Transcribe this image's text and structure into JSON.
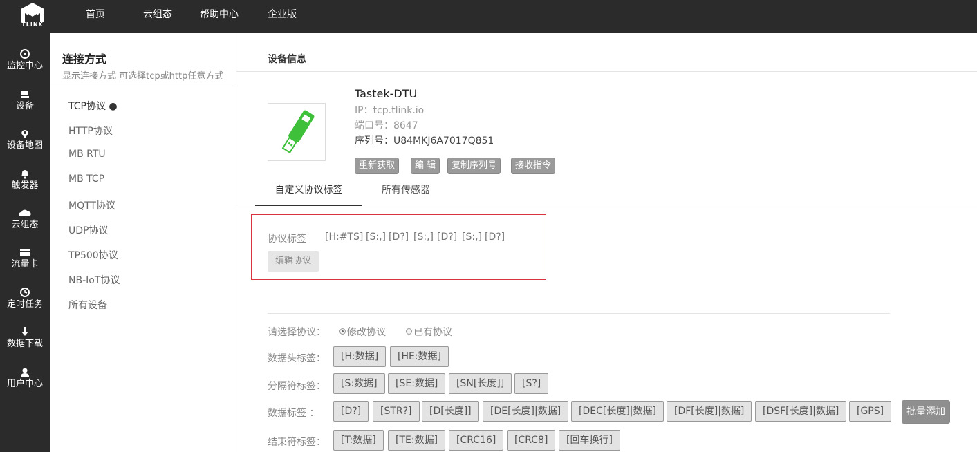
{
  "brand": {
    "logo_text": "TLINK"
  },
  "topnav": [
    {
      "label": "首页"
    },
    {
      "label": "云组态"
    },
    {
      "label": "帮助中心"
    },
    {
      "label": "企业版"
    }
  ],
  "rail": [
    {
      "label": "监控中心",
      "icon": "monitor-icon"
    },
    {
      "label": "设备",
      "icon": "device-icon"
    },
    {
      "label": "设备地图",
      "icon": "map-pin-icon"
    },
    {
      "label": "触发器",
      "icon": "bell-icon"
    },
    {
      "label": "云组态",
      "icon": "cloud-icon"
    },
    {
      "label": "流量卡",
      "icon": "card-icon"
    },
    {
      "label": "定时任务",
      "icon": "clock-icon"
    },
    {
      "label": "数据下载",
      "icon": "download-icon"
    },
    {
      "label": "用户中心",
      "icon": "user-icon"
    }
  ],
  "panel": {
    "title": "连接方式",
    "subtitle": "显示连接方式 可选择tcp或http任意方式",
    "items": [
      {
        "label": "TCP协议 ●"
      },
      {
        "label": "HTTP协议"
      },
      {
        "label": "MB RTU"
      },
      {
        "label": "MB TCP"
      },
      {
        "label": "MQTT协议"
      },
      {
        "label": "UDP协议"
      },
      {
        "label": "TP500协议"
      },
      {
        "label": "NB-IoT协议"
      },
      {
        "label": "所有设备"
      }
    ]
  },
  "main": {
    "title": "设备信息",
    "device": {
      "name": "Tastek-DTU",
      "ip": "IP：tcp.tlink.io",
      "port": "端口号：8647",
      "serial": "序列号：U84MKJ6A7017Q851"
    },
    "actions": [
      {
        "label": "重新获取"
      },
      {
        "label": "编 辑"
      },
      {
        "label": "复制序列号"
      },
      {
        "label": "接收指令"
      }
    ],
    "tabs": [
      {
        "label": "自定义协议标签"
      },
      {
        "label": "所有传感器"
      }
    ],
    "protocol": {
      "label": "协议标签",
      "tags": [
        "[H:#TS]",
        "[S:,]",
        "[D?]",
        "[S:,]",
        "[D?]",
        "[S:,]",
        "[D?]"
      ],
      "edit_button": "编辑协议"
    },
    "select_protocol": {
      "label": "请选择协议：",
      "options": [
        {
          "label": "修改协议",
          "checked": true
        },
        {
          "label": "已有协议",
          "checked": false
        }
      ]
    },
    "header_tags": {
      "label": "数据头标签：",
      "items": [
        "[H:数据]",
        "[HE:数据]"
      ]
    },
    "separator_tags": {
      "label": "分隔符标签：",
      "items": [
        "[S:数据]",
        "[SE:数据]",
        "[SN[长度]]",
        "[S?]"
      ]
    },
    "data_tags": {
      "label": "数据标签 ：",
      "items": [
        "[D?]",
        "[STR?]",
        "[D[长度]]",
        "[DE[长度]|数据]",
        "[DEC[长度]|数据]",
        "[DF[长度]|数据]",
        "[DSF[长度]|数据]",
        "[GPS]"
      ],
      "batch_label": "批量添加"
    },
    "end_tags": {
      "label": "结束符标签：",
      "items": [
        "[T:数据]",
        "[TE:数据]",
        "[CRC16]",
        "[CRC8]",
        "[回车换行]"
      ]
    }
  },
  "colors": {
    "dark_bg": "#2b2b2b",
    "device_green": "#3ec03b",
    "highlight_red": "#d9333f"
  }
}
